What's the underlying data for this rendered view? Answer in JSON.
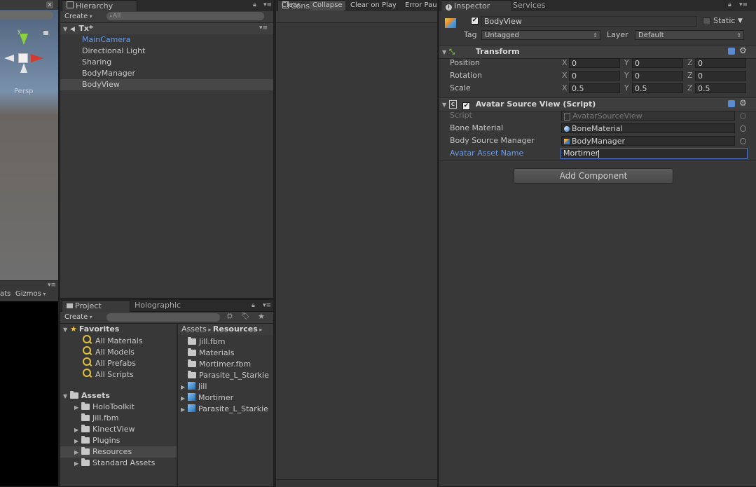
{
  "scene": {
    "persp_label": "Persp",
    "stats_label": "ats",
    "gizmos_label": "Gizmos"
  },
  "hierarchy": {
    "tab": "Hierarchy",
    "create_label": "Create",
    "search_placeholder": "All",
    "scene_name": "Tx*",
    "items": [
      {
        "label": "MainCamera"
      },
      {
        "label": "Directional Light"
      },
      {
        "label": "Sharing"
      },
      {
        "label": "BodyManager"
      },
      {
        "label": "BodyView"
      }
    ]
  },
  "console": {
    "tab": "Console",
    "buttons": [
      "Clear",
      "Collapse",
      "Clear on Play",
      "Error Pau"
    ]
  },
  "project": {
    "tabs": [
      "Project",
      "Holographic"
    ],
    "create_label": "Create",
    "favorites": {
      "label": "Favorites",
      "items": [
        "All Materials",
        "All Models",
        "All Prefabs",
        "All Scripts"
      ]
    },
    "assets": {
      "label": "Assets",
      "items": [
        "HoloToolkit",
        "Jill.fbm",
        "KinectView",
        "Plugins",
        "Resources",
        "Standard Assets"
      ]
    },
    "breadcrumb": [
      "Assets",
      "Resources"
    ],
    "files": [
      {
        "label": "Jill.fbm"
      },
      {
        "label": "Materials"
      },
      {
        "label": "Mortimer.fbm"
      },
      {
        "label": "Parasite_L_Starkie"
      },
      {
        "label": "Jill"
      },
      {
        "label": "Mortimer"
      },
      {
        "label": "Parasite_L_Starkie"
      }
    ]
  },
  "inspector": {
    "tabs": [
      "Inspector",
      "Services"
    ],
    "object_name": "BodyView",
    "static_label": "Static",
    "tag_label": "Tag",
    "tag_value": "Untagged",
    "layer_label": "Layer",
    "layer_value": "Default",
    "transform": {
      "title": "Transform",
      "position_label": "Position",
      "rotation_label": "Rotation",
      "scale_label": "Scale",
      "axes": [
        "X",
        "Y",
        "Z"
      ],
      "position": [
        "0",
        "0",
        "0"
      ],
      "rotation": [
        "0",
        "0",
        "0"
      ],
      "scale": [
        "0.5",
        "0.5",
        "0.5"
      ]
    },
    "script": {
      "title": "Avatar Source View (Script)",
      "script_label": "Script",
      "script_value": "AvatarSourceView",
      "bone_material_label": "Bone Material",
      "bone_material_value": "BoneMaterial",
      "body_source_label": "Body Source Manager",
      "body_source_value": "BodyManager",
      "avatar_asset_label": "Avatar Asset Name",
      "avatar_asset_value": "Mortimer"
    },
    "add_component": "Add Component"
  }
}
